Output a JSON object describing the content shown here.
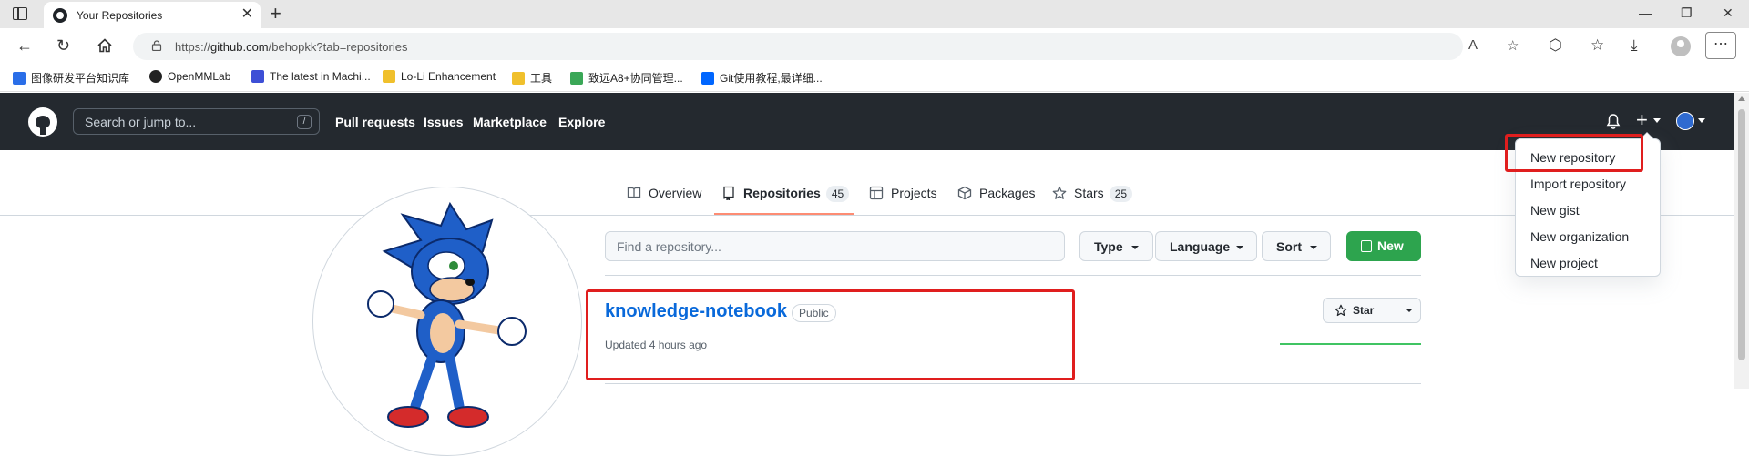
{
  "browser": {
    "tab_title": "Your Repositories",
    "tab_close": "✕",
    "new_tab": "+",
    "url_prefix": "https://",
    "url_host": "github.com",
    "url_path": "/behopkk?tab=repositories",
    "window_controls": [
      "—",
      "❐",
      "✕"
    ],
    "menu": "⋯",
    "bookmarks": [
      {
        "label": "图像研发平台知识库",
        "icon_color": "#2a6ee8"
      },
      {
        "label": "OpenMMLab",
        "icon_color": "#222222"
      },
      {
        "label": "The latest in Machi...",
        "icon_color": "#3d4fd6"
      },
      {
        "label": "Lo-Li Enhancement",
        "icon_color": "#f0c02c"
      },
      {
        "label": "工具",
        "icon_color": "#f0c02c"
      },
      {
        "label": "致远A8+协同管理...",
        "icon_color": "#3aa757"
      },
      {
        "label": "Git使用教程,最详细...",
        "icon_color": "#0066ff"
      }
    ]
  },
  "github": {
    "search_placeholder": "Search or jump to...",
    "search_key": "/",
    "nav": [
      "Pull requests",
      "Issues",
      "Marketplace",
      "Explore"
    ],
    "plus": "+"
  },
  "profile_tabs": [
    {
      "label": "Overview",
      "icon": "book-icon"
    },
    {
      "label": "Repositories",
      "icon": "repo-icon",
      "count": "45",
      "selected": true
    },
    {
      "label": "Projects",
      "icon": "table-icon"
    },
    {
      "label": "Packages",
      "icon": "package-icon"
    },
    {
      "label": "Stars",
      "icon": "star-icon",
      "count": "25"
    }
  ],
  "repo_controls": {
    "find_placeholder": "Find a repository...",
    "type": "Type",
    "language": "Language",
    "sort": "Sort",
    "new": "New"
  },
  "repos": [
    {
      "name": "knowledge-notebook",
      "visibility": "Public",
      "updated": "Updated 4 hours ago",
      "star_label": "Star"
    }
  ],
  "create_menu": [
    "New repository",
    "Import repository",
    "New gist",
    "New organization",
    "New project"
  ],
  "colors": {
    "header_bg": "#24292f",
    "accent_green": "#2da44e",
    "link_blue": "#0969da",
    "highlight_red": "#e01e1e",
    "tab_underline": "#fd8c73"
  }
}
